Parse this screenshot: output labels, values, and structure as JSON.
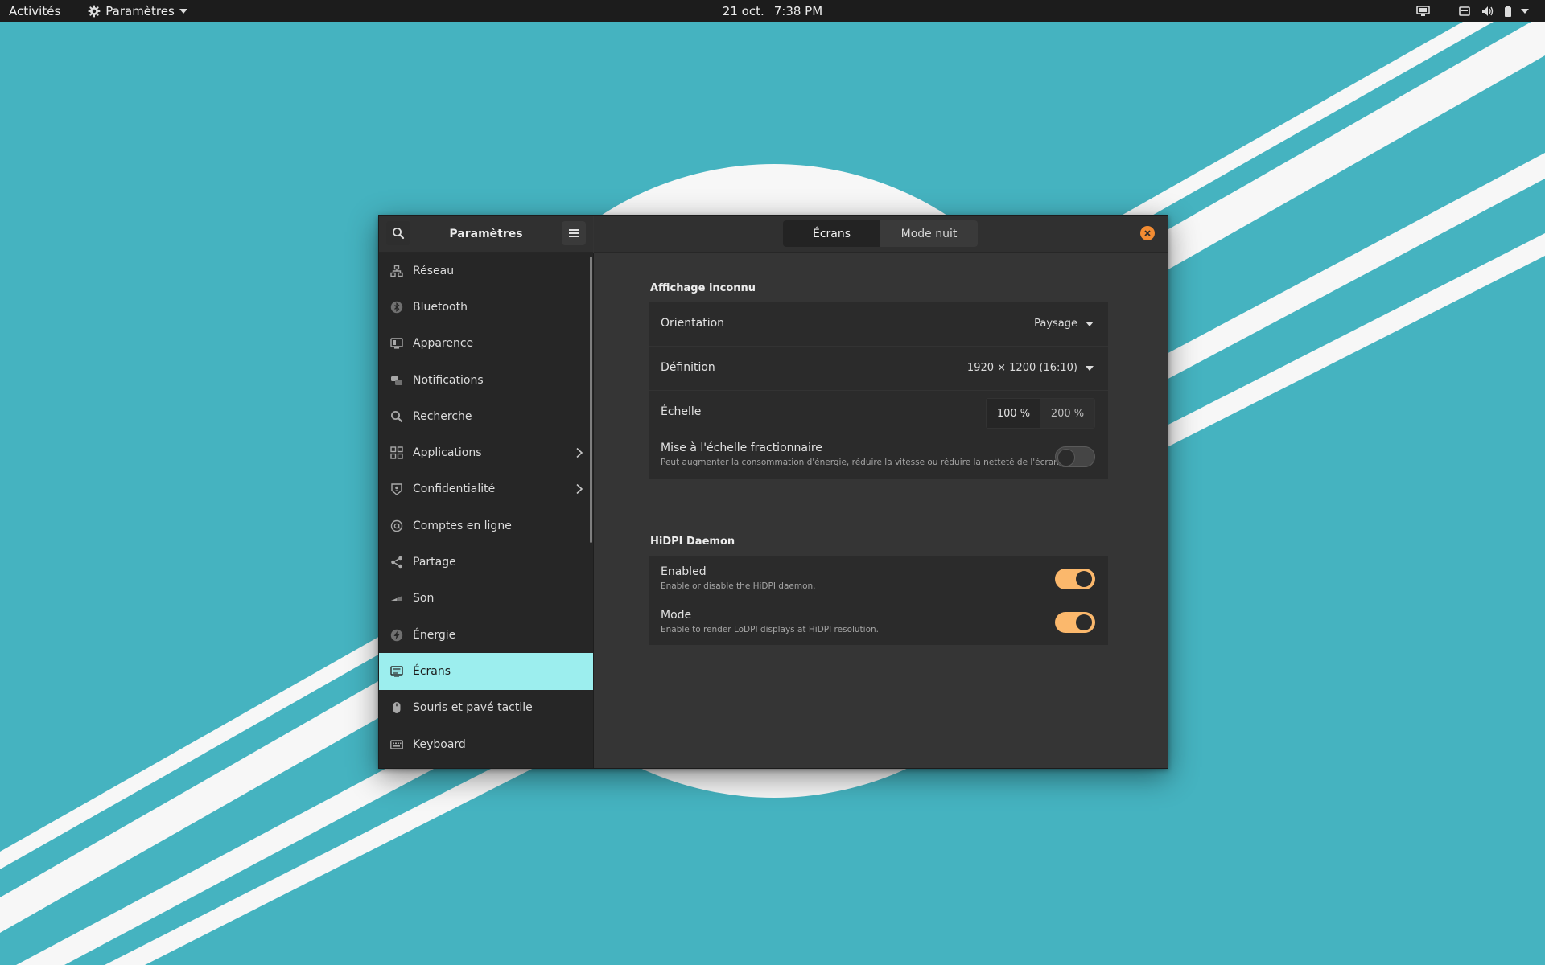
{
  "top_bar": {
    "activities": "Activités",
    "app_menu_label": "Paramètres",
    "date": "21 oct.",
    "time": "7:38 PM",
    "tray_icons": [
      "display-icon",
      "keyboard-layout-icon",
      "volume-icon",
      "battery-icon",
      "system-menu-chevron-icon"
    ]
  },
  "window": {
    "sidebar_title": "Paramètres",
    "tabs": [
      {
        "label": "Écrans",
        "active": true
      },
      {
        "label": "Mode nuit",
        "active": false
      }
    ],
    "accent_color": "#9ceeee",
    "close_color": "#f28b32",
    "toggle_on_color": "#fbb86c"
  },
  "sidebar": {
    "items": [
      {
        "label": "Réseau",
        "icon": "network-icon"
      },
      {
        "label": "Bluetooth",
        "icon": "bluetooth-icon"
      },
      {
        "label": "Apparence",
        "icon": "appearance-icon"
      },
      {
        "label": "Notifications",
        "icon": "notifications-icon"
      },
      {
        "label": "Recherche",
        "icon": "search-icon"
      },
      {
        "label": "Applications",
        "icon": "applications-icon",
        "has_submenu": true
      },
      {
        "label": "Confidentialité",
        "icon": "privacy-icon",
        "has_submenu": true
      },
      {
        "label": "Comptes en ligne",
        "icon": "online-accounts-icon"
      },
      {
        "label": "Partage",
        "icon": "sharing-icon"
      },
      {
        "label": "Son",
        "icon": "sound-icon"
      },
      {
        "label": "Énergie",
        "icon": "power-icon"
      },
      {
        "label": "Écrans",
        "icon": "displays-icon",
        "active": true
      },
      {
        "label": "Souris et pavé tactile",
        "icon": "mouse-icon"
      },
      {
        "label": "Keyboard",
        "icon": "keyboard-icon"
      }
    ]
  },
  "content": {
    "display_section": {
      "title": "Affichage inconnu",
      "orientation": {
        "label": "Orientation",
        "value": "Paysage"
      },
      "resolution": {
        "label": "Définition",
        "value": "1920 × 1200 (16:10)"
      },
      "scale": {
        "label": "Échelle",
        "options": [
          "100 %",
          "200 %"
        ],
        "selected": "200 %"
      },
      "fractional": {
        "label": "Mise à l'échelle fractionnaire",
        "description": "Peut augmenter la consommation d'énergie, réduire la vitesse ou réduire la netteté de l'écran.",
        "enabled": false
      }
    },
    "hidpi_section": {
      "title": "HiDPI Daemon",
      "enabled": {
        "label": "Enabled",
        "description": "Enable or disable the HiDPI daemon.",
        "value": true
      },
      "mode": {
        "label": "Mode",
        "description": "Enable to render LoDPI displays at HiDPI resolution.",
        "value": true
      }
    }
  }
}
